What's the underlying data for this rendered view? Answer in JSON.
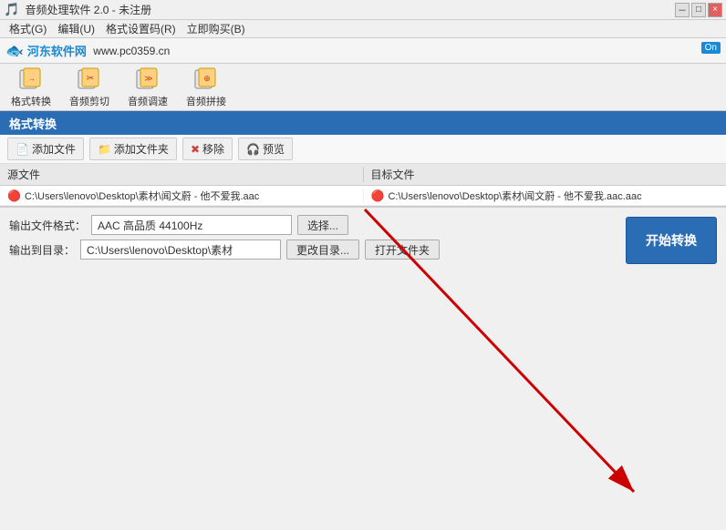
{
  "window": {
    "title": "音频处理软件 2.0 - 未注册",
    "controls": {
      "minimize": "－",
      "maximize": "□",
      "close": "×"
    }
  },
  "menu": {
    "items": [
      "格式(G)",
      "编辑(U)",
      "格式设置码(R)",
      "立即购买(B)"
    ]
  },
  "logo": {
    "site": "河东软件网",
    "url": "www.pc0359.cn"
  },
  "on_badge": "On",
  "toolbar": {
    "buttons": [
      {
        "label": "格式转换",
        "icon": "🔄"
      },
      {
        "label": "音频剪切",
        "icon": "✂"
      },
      {
        "label": "音频调速",
        "icon": "⚡"
      },
      {
        "label": "音频拼接",
        "icon": "🔗"
      }
    ]
  },
  "section": {
    "title": "格式转换"
  },
  "action_bar": {
    "buttons": [
      {
        "label": "添加文件",
        "icon": "📄"
      },
      {
        "label": "添加文件夹",
        "icon": "📁"
      },
      {
        "label": "移除",
        "icon": "✖"
      },
      {
        "label": "预览",
        "icon": "🎧"
      }
    ]
  },
  "file_list": {
    "col_src": "源文件",
    "col_dst": "目标文件",
    "rows": [
      {
        "src": "C:\\Users\\lenovo\\Desktop\\素材\\闻文蔚 - 他不爱我.aac",
        "dst": "C:\\Users\\lenovo\\Desktop\\素材\\闻文蔚 - 他不爱我.aac.aac"
      }
    ]
  },
  "bottom": {
    "format_label": "输出文件格式：",
    "format_value": "AAC 高品质 44100Hz",
    "format_btn": "选择...",
    "dir_label": "输出到目录：",
    "dir_value": "C:\\Users\\lenovo\\Desktop\\素材",
    "dir_btn1": "更改目录...",
    "dir_btn2": "打开文件夹",
    "start_btn": "开始转换"
  },
  "arrow": {
    "color": "#cc0000"
  }
}
